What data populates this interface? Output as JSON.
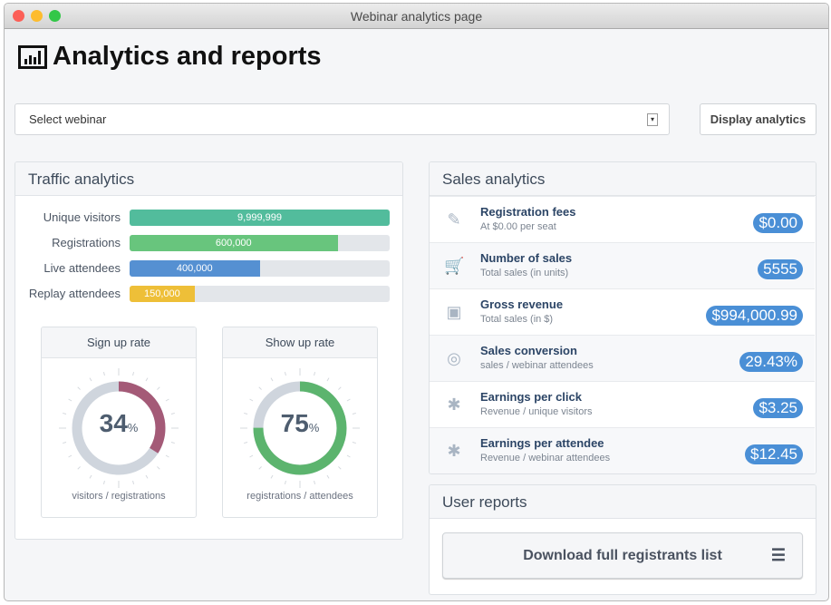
{
  "window": {
    "title": "Webinar analytics page"
  },
  "header": {
    "title": "Analytics and reports",
    "icon": "bar-chart-icon"
  },
  "controls": {
    "select_value": "Select webinar",
    "display_label": "Display analytics"
  },
  "traffic": {
    "title": "Traffic analytics",
    "bars": [
      {
        "label": "Unique visitors",
        "value": "9,999,999",
        "fraction": 1.0,
        "color": "#52bc9c"
      },
      {
        "label": "Registrations",
        "value": "600,000",
        "fraction": 0.8,
        "color": "#68c57d"
      },
      {
        "label": "Live attendees",
        "value": "400,000",
        "fraction": 0.5,
        "color": "#5590d2"
      },
      {
        "label": "Replay attendees",
        "value": "150,000",
        "fraction": 0.25,
        "color": "#eebf38"
      }
    ],
    "gauges": [
      {
        "title": "Sign up rate",
        "value": "34",
        "percent": 34,
        "unit": "%",
        "caption": "visitors / registrations",
        "color": "#a45a77"
      },
      {
        "title": "Show up rate",
        "value": "75",
        "percent": 75,
        "unit": "%",
        "caption": "registrations / attendees",
        "color": "#5cb46e"
      }
    ]
  },
  "sales": {
    "title": "Sales analytics",
    "rows": [
      {
        "icon": "edit-icon",
        "title": "Registration fees",
        "sub": "At $0.00 per seat",
        "value": "$0.00"
      },
      {
        "icon": "cart-icon",
        "title": "Number of sales",
        "sub": "Total sales (in units)",
        "value": "5555"
      },
      {
        "icon": "money-icon",
        "title": "Gross revenue",
        "sub": "Total sales (in $)",
        "value": "$994,000.99"
      },
      {
        "icon": "target-icon",
        "title": "Sales conversion",
        "sub": "sales / webinar attendees",
        "value": "29.43%"
      },
      {
        "icon": "asterisk-icon",
        "title": "Earnings per click",
        "sub": "Revenue / unique visitors",
        "value": "$3.25"
      },
      {
        "icon": "asterisk-icon",
        "title": "Earnings per attendee",
        "sub": "Revenue / webinar attendees",
        "value": "$12.45"
      }
    ]
  },
  "reports": {
    "title": "User reports",
    "download_label": "Download full registrants list"
  },
  "colors": {
    "badge": "#4a8fd6",
    "track": "#e3e6ea",
    "ring_track": "#cfd5dd"
  }
}
